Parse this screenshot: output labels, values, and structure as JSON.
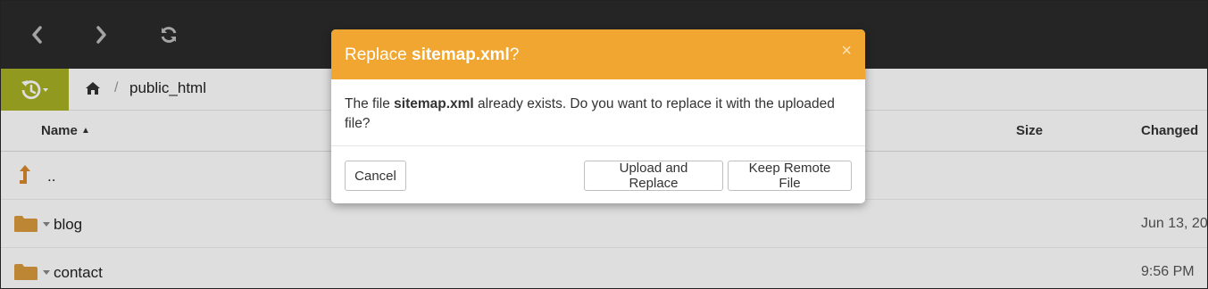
{
  "toolbar": {
    "back_icon": "chevron-left-icon",
    "forward_icon": "chevron-right-icon",
    "refresh_icon": "refresh-icon"
  },
  "breadcrumb": {
    "history_icon": "history-icon",
    "home_icon": "home-icon",
    "separator": "/",
    "path": "public_html"
  },
  "table": {
    "columns": {
      "name": "Name",
      "size": "Size",
      "changed": "Changed"
    },
    "sort_indicator": "▲",
    "rows": [
      {
        "name": "..",
        "changed": "",
        "icon": "parent-dir-icon"
      },
      {
        "name": "blog",
        "changed": "Jun 13, 20",
        "icon": "folder-icon"
      },
      {
        "name": "contact",
        "changed": "9:56 PM",
        "icon": "folder-icon"
      }
    ]
  },
  "dialog": {
    "title_prefix": "Replace ",
    "title_file": "sitemap.xml",
    "title_suffix": "?",
    "close": "×",
    "body_prefix": "The file ",
    "body_file": "sitemap.xml",
    "body_suffix": " already exists. Do you want to replace it with the uploaded file?",
    "cancel_label": "Cancel",
    "upload_replace_label": "Upload and Replace",
    "keep_remote_label": "Keep Remote File"
  },
  "colors": {
    "topbar": "#2b2b2b",
    "history_button": "#a8b024",
    "dialog_header": "#f0a630",
    "folder": "#d99a3c"
  }
}
